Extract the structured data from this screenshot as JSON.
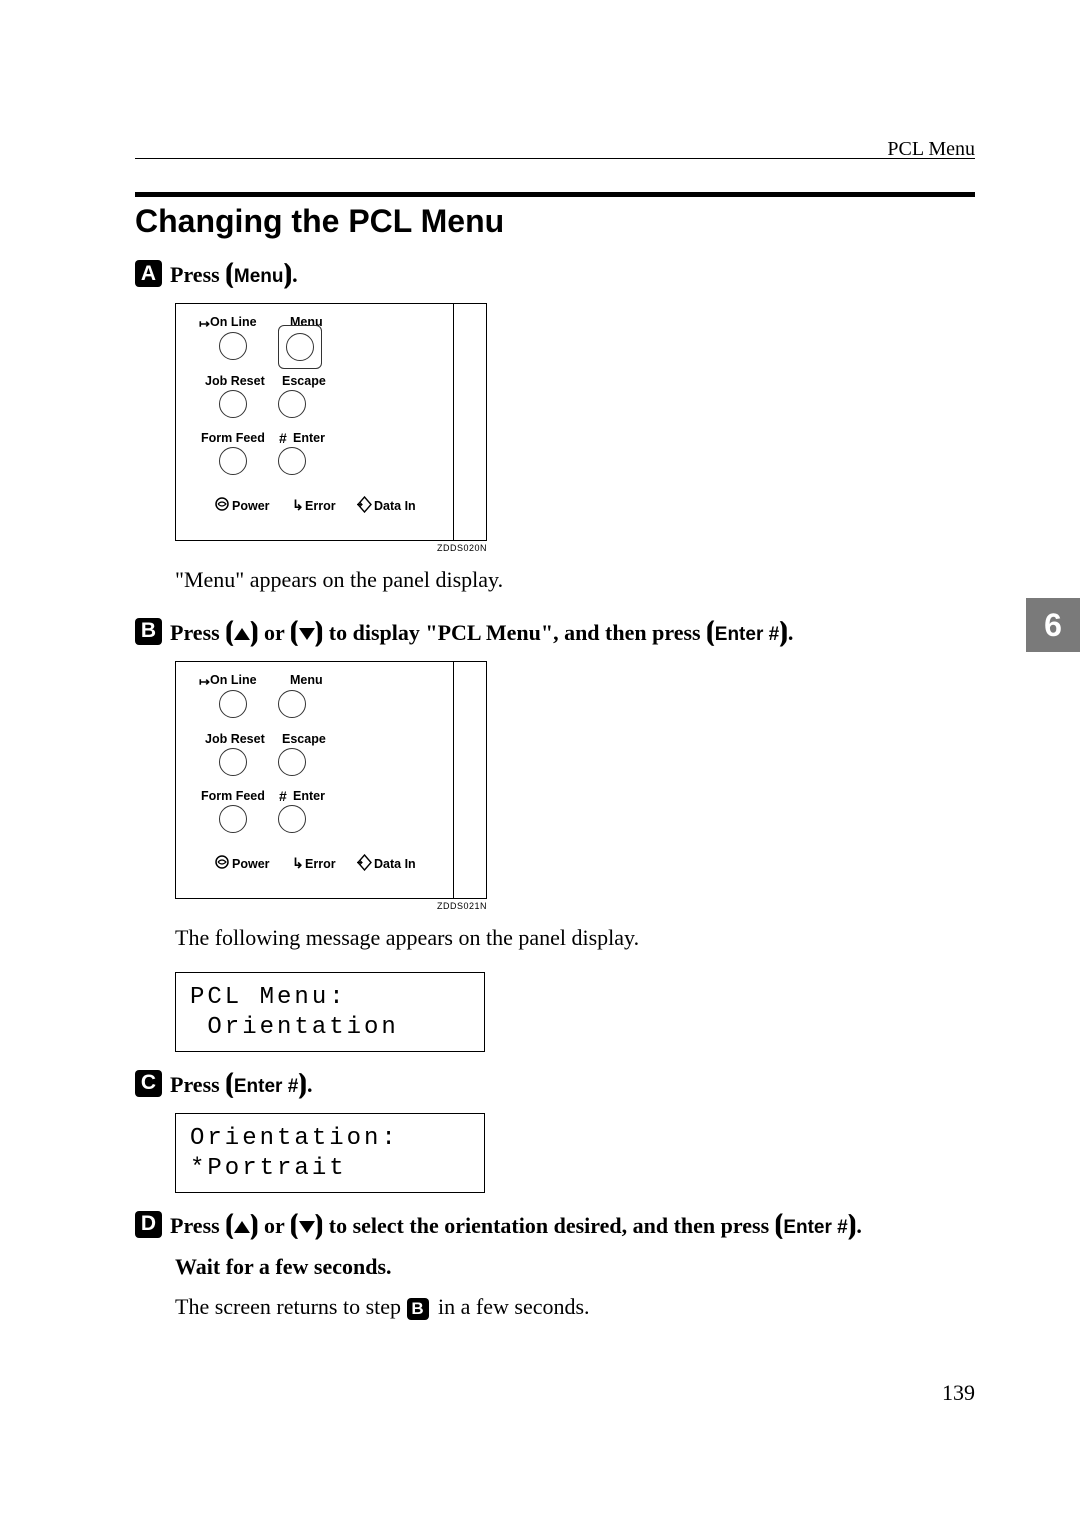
{
  "running_header": "PCL Menu",
  "section_title": "Changing the PCL Menu",
  "chapter_tab": "6",
  "page_number": "139",
  "panel_labels": {
    "online": "On Line",
    "menu": "Menu",
    "jobreset": "Job Reset",
    "escape": "Escape",
    "formfeed": "Form Feed",
    "enter": "Enter",
    "power": "Power",
    "error": "Error",
    "datain": "Data In"
  },
  "fig_codes": {
    "a": "ZDDS020N",
    "b": "ZDDS021N"
  },
  "steps": {
    "s1": {
      "num": "A",
      "pre": "Press ",
      "key": "Menu",
      "post": "."
    },
    "s1_body": "\"Menu\" appears on the panel display.",
    "s2": {
      "num": "B",
      "pre": "Press ",
      "mid": " or ",
      "tail": " to display \"PCL Menu\", and then press ",
      "key": "Enter #",
      "post": "."
    },
    "s2_body": "The following message appears on the panel display.",
    "s3": {
      "num": "C",
      "pre": "Press ",
      "key": "Enter #",
      "post": "."
    },
    "s4": {
      "num": "D",
      "pre": "Press ",
      "mid": " or ",
      "tail": " to select the orientation desired, and then press ",
      "key": "Enter #",
      "post": "."
    },
    "s4_cont": "Wait for a few seconds.",
    "s4_body_a": "The screen returns to step ",
    "s4_body_ref": "B",
    "s4_body_b": " in a few seconds."
  },
  "lcd": {
    "d1_l1": "PCL Menu:",
    "d1_l2": " Orientation",
    "d2_l1": "Orientation:",
    "d2_l2": "*Portrait"
  }
}
